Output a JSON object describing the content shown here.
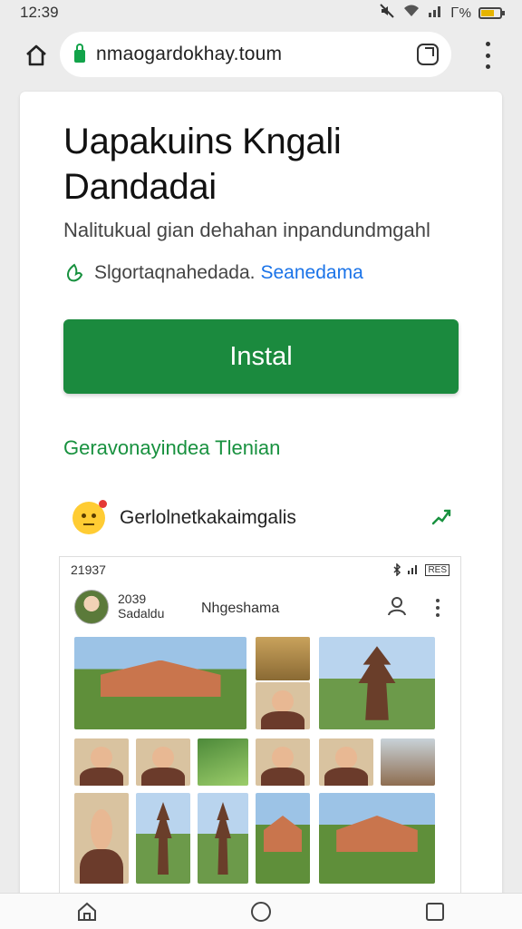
{
  "status": {
    "time": "12:39",
    "signal": "Ꮁ%"
  },
  "browser": {
    "url_prefix": "nmao",
    "url_host": "gardokhay.toum"
  },
  "app": {
    "title": "Uapakuins Kngali Dandadai",
    "subtitle": "Nalitukual gian dehahan inpandundmgahl",
    "rating_text": "Slgortaqnahedada.",
    "rating_link": "Seanedama",
    "install_label": "Instal",
    "green_link": "Geravonayindea Tlenian",
    "notification_text": "Gerlolnetkakaimgalis"
  },
  "inner": {
    "status_time": "21937",
    "battery_label": "RES",
    "date": "2039",
    "date_sub": "Sadaldu",
    "name": "Nhgeshama"
  },
  "colors": {
    "install": "#1b8a3e",
    "link_blue": "#1a73e8",
    "link_green": "#18913f"
  },
  "icons": [
    "home-icon",
    "lock-icon",
    "tabs-icon",
    "more-vert-icon",
    "leaf-icon",
    "emoji-icon",
    "share-icon",
    "person-icon",
    "nav-home-icon",
    "nav-circle-icon",
    "nav-square-icon"
  ]
}
